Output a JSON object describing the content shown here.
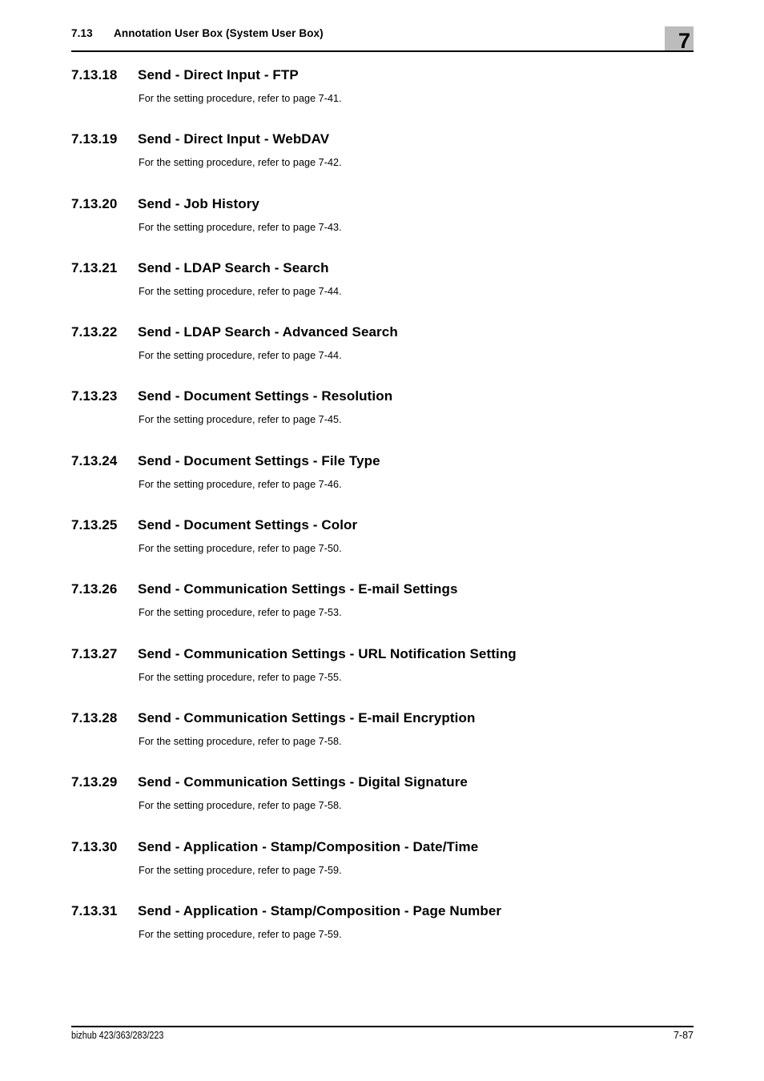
{
  "header": {
    "section_number": "7.13",
    "section_title": "Annotation User Box (System User Box)",
    "chapter_badge": "7",
    "badge_color": "#bcbcbc"
  },
  "sections": [
    {
      "number": "7.13.18",
      "title": "Send - Direct Input - FTP",
      "body": "For the setting procedure, refer to page 7-41."
    },
    {
      "number": "7.13.19",
      "title": "Send - Direct Input - WebDAV",
      "body": "For the setting procedure, refer to page 7-42."
    },
    {
      "number": "7.13.20",
      "title": "Send - Job History",
      "body": "For the setting procedure, refer to page 7-43."
    },
    {
      "number": "7.13.21",
      "title": "Send - LDAP Search - Search",
      "body": "For the setting procedure, refer to page 7-44."
    },
    {
      "number": "7.13.22",
      "title": "Send - LDAP Search - Advanced Search",
      "body": "For the setting procedure, refer to page 7-44."
    },
    {
      "number": "7.13.23",
      "title": "Send - Document Settings - Resolution",
      "body": "For the setting procedure, refer to page 7-45."
    },
    {
      "number": "7.13.24",
      "title": "Send - Document Settings - File Type",
      "body": "For the setting procedure, refer to page 7-46."
    },
    {
      "number": "7.13.25",
      "title": "Send - Document Settings - Color",
      "body": "For the setting procedure, refer to page 7-50."
    },
    {
      "number": "7.13.26",
      "title": "Send - Communication Settings - E-mail Settings",
      "body": "For the setting procedure, refer to page 7-53."
    },
    {
      "number": "7.13.27",
      "title": "Send - Communication Settings - URL Notification Setting",
      "body": "For the setting procedure, refer to page 7-55."
    },
    {
      "number": "7.13.28",
      "title": "Send - Communication Settings - E-mail Encryption",
      "body": "For the setting procedure, refer to page 7-58."
    },
    {
      "number": "7.13.29",
      "title": "Send - Communication Settings - Digital Signature",
      "body": "For the setting procedure, refer to page 7-58."
    },
    {
      "number": "7.13.30",
      "title": "Send - Application - Stamp/Composition - Date/Time",
      "body": "For the setting procedure, refer to page 7-59."
    },
    {
      "number": "7.13.31",
      "title": "Send - Application - Stamp/Composition - Page Number",
      "body": "For the setting procedure, refer to page 7-59."
    }
  ],
  "footer": {
    "product": "bizhub 423/363/283/223",
    "page_number": "7-87"
  }
}
